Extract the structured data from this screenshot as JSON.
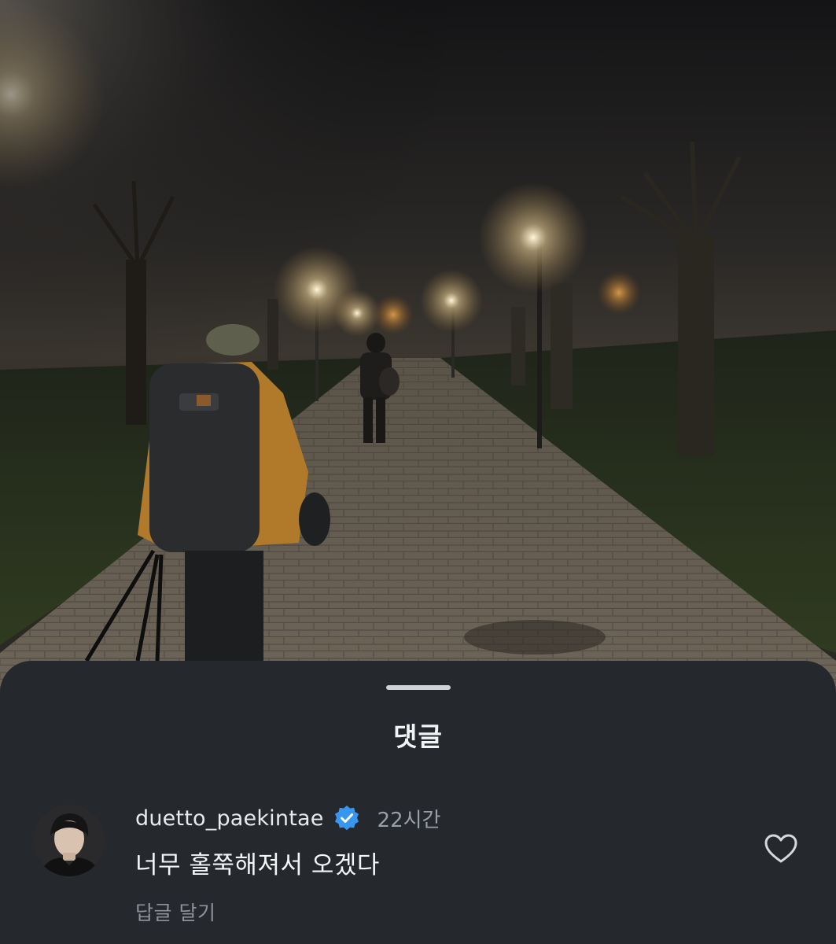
{
  "photo": {
    "icon": "foggy-night-path-photo"
  },
  "sheet": {
    "title": "댓글"
  },
  "comment": {
    "username": "duetto_paekintae",
    "verified_icon": "verified-badge-icon",
    "timestamp": "22시간",
    "text": "너무 홀쭉해져서 오겠다",
    "reply_label": "답글 달기",
    "like_icon": "heart-outline-icon"
  },
  "colors": {
    "sheet_bg": "#25282d",
    "verified_blue": "#3797f0",
    "muted_text": "#9a9ea5"
  }
}
